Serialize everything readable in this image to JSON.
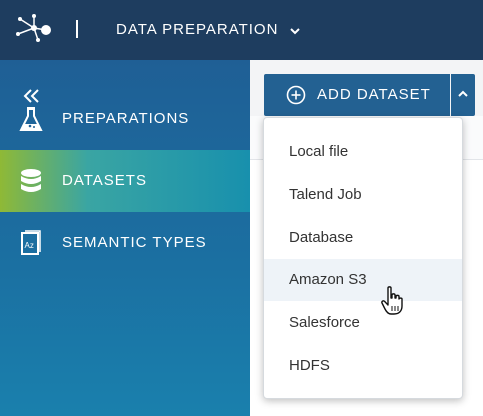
{
  "header": {
    "app_name": "DATA PREPARATION",
    "logo_icon": "talend-logo-icon",
    "menu_icon": "chevron-down-icon"
  },
  "sidebar": {
    "collapse_icon": "double-chevron-left-icon",
    "items": [
      {
        "label": "PREPARATIONS",
        "icon": "flask-icon",
        "active": false
      },
      {
        "label": "DATASETS",
        "icon": "database-icon",
        "active": true
      },
      {
        "label": "SEMANTIC TYPES",
        "icon": "dictionary-icon",
        "active": false
      }
    ]
  },
  "toolbar": {
    "add_dataset_label": "ADD DATASET",
    "add_icon": "plus-circle-icon",
    "caret_icon": "chevron-up-icon"
  },
  "dataset_menu": {
    "items": [
      "Local file",
      "Talend Job",
      "Database",
      "Amazon S3",
      "Salesforce",
      "HDFS"
    ],
    "hovered": "Amazon S3"
  },
  "colors": {
    "topbar": "#1e3d5f",
    "sidebar_top": "#1f5f95",
    "sidebar_bottom": "#1a80ad",
    "active_start": "#8fb936",
    "active_end": "#1890ad",
    "button": "#236192"
  }
}
